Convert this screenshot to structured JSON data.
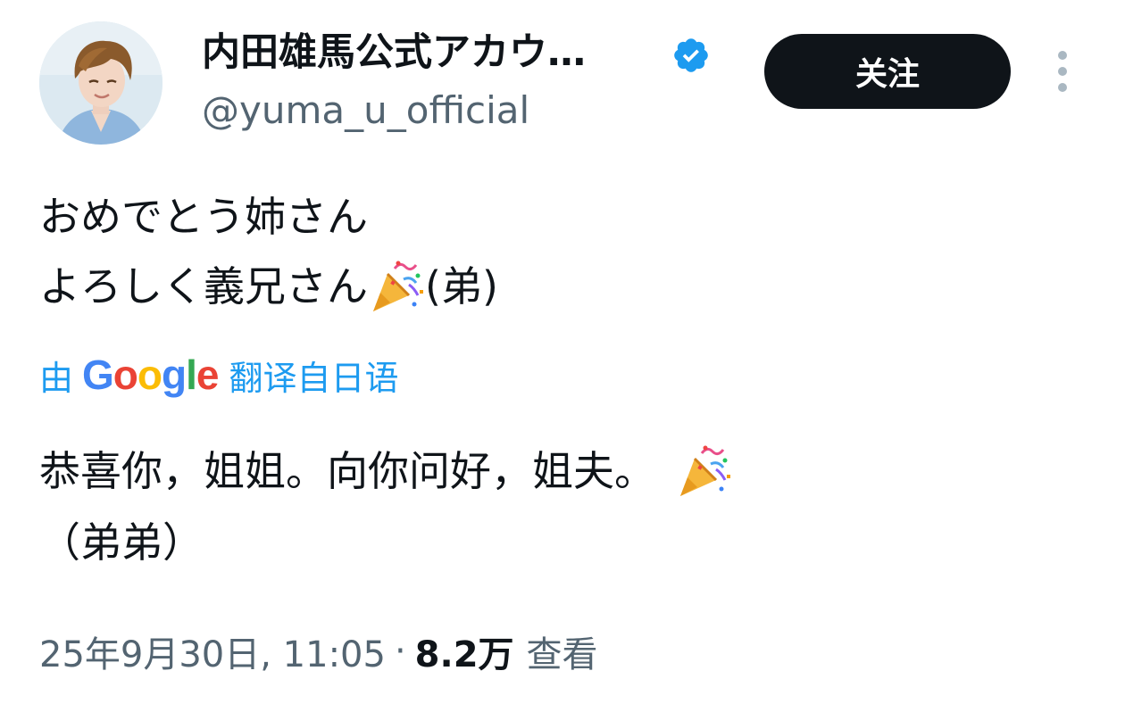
{
  "header": {
    "display_name": "内田雄馬公式アカウ…",
    "handle": "@yuma_u_official",
    "follow_label": "关注"
  },
  "icons": {
    "avatar": "avatar",
    "verified": "verified-badge-icon",
    "more": "more-vertical-icon",
    "emoji": "party-popper-icon"
  },
  "colors": {
    "verified_badge": "#1d9bf0",
    "link_blue": "#1d9bf0",
    "follow_bg": "#0f1419",
    "secondary_text": "#536471"
  },
  "tweet": {
    "line1": "おめでとう姉さん",
    "line2_prefix": "よろしく義兄さん",
    "line2_suffix": "(弟)"
  },
  "translation": {
    "by": "由",
    "google_letters": [
      "G",
      "o",
      "o",
      "g",
      "l",
      "e"
    ],
    "google_colors": [
      "#4285F4",
      "#EA4335",
      "#FBBC05",
      "#4285F4",
      "#34A853",
      "#EA4335"
    ],
    "suffix": "翻译自日语",
    "line1": "恭喜你，姐姐。向你问好，姐夫。",
    "line2": "（弟弟）"
  },
  "meta": {
    "timestamp": "25年9月30日, 11:05",
    "separator": "·",
    "views_count": "8.2万",
    "views_label": "查看"
  }
}
